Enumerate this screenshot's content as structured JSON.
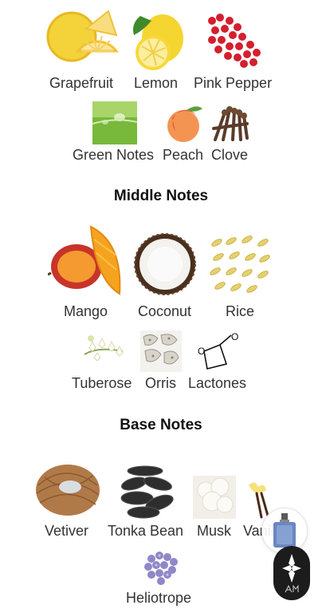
{
  "top_notes": {
    "items": [
      {
        "label": "Grapefruit",
        "icon": "grapefruit-icon"
      },
      {
        "label": "Lemon",
        "icon": "lemon-icon"
      },
      {
        "label": "Pink Pepper",
        "icon": "pink-pepper-icon"
      },
      {
        "label": "Green Notes",
        "icon": "green-notes-icon"
      },
      {
        "label": "Peach",
        "icon": "peach-icon"
      },
      {
        "label": "Clove",
        "icon": "clove-icon"
      }
    ]
  },
  "middle_notes": {
    "title": "Middle Notes",
    "items": [
      {
        "label": "Mango",
        "icon": "mango-icon"
      },
      {
        "label": "Coconut",
        "icon": "coconut-icon"
      },
      {
        "label": "Rice",
        "icon": "rice-icon"
      },
      {
        "label": "Tuberose",
        "icon": "tuberose-icon"
      },
      {
        "label": "Orris",
        "icon": "orris-icon"
      },
      {
        "label": "Lactones",
        "icon": "lactones-icon"
      }
    ]
  },
  "base_notes": {
    "title": "Base Notes",
    "items": [
      {
        "label": "Vetiver",
        "icon": "vetiver-icon"
      },
      {
        "label": "Tonka Bean",
        "icon": "tonka-bean-icon"
      },
      {
        "label": "Musk",
        "icon": "musk-icon"
      },
      {
        "label": "Vanilla",
        "icon": "vanilla-icon"
      },
      {
        "label": "Heliotrope",
        "icon": "heliotrope-icon"
      }
    ]
  },
  "floating": {
    "perfume_button_icon": "perfume-bottle-icon",
    "app_button_icon": "app-logo-icon"
  },
  "colors": {
    "background": "#ffffff",
    "text": "#333333",
    "fab_dark": "#1c1c1c"
  }
}
